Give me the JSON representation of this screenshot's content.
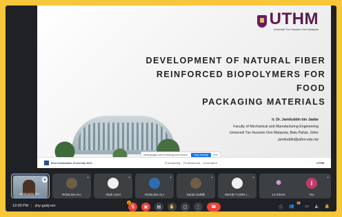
{
  "slide": {
    "logo": "UTHM",
    "logo_sub": "Universiti Tun Hussein Onn Malaysia",
    "title_lines": [
      "DEVELOPMENT OF NATURAL FIBER",
      "REINFORCED BIOPOLYMERS FOR FOOD",
      "PACKAGING MATERIALS"
    ],
    "author": {
      "name": "Ir. Dr. Jamiluddin bin Jaafar",
      "faculty": "Faculty of Mechanical and Manufacturing Engineering",
      "university": "Universiti Tun Hussein Onn Malaysia, Batu Pahat, Johor",
      "email": "jamiluddin@uthm.edu.my"
    },
    "share_bar": {
      "text": "meet.google.com is sharing your screen.",
      "stop": "Stop sharing",
      "hide": "Hide"
    },
    "footer": {
      "left": "Best Sustainable University 2023",
      "middle": "Trustworthy · Professional · Innovative",
      "right": "UTHM"
    }
  },
  "participants": [
    {
      "name": "Jamiluddin bin...",
      "type": "video"
    },
    {
      "name": "ROSLINA ALI",
      "type": "photo"
    },
    {
      "name": "Aliah Azmi",
      "type": "photo"
    },
    {
      "name": "ROSLINA ALI",
      "type": "photo"
    },
    {
      "name": "Sarah Zulkifli",
      "type": "photo"
    },
    {
      "name": "MOHD YUSRI I...",
      "type": "photo"
    },
    {
      "name": "13 others",
      "type": "others"
    },
    {
      "name": "You",
      "type": "initial",
      "initial": "I"
    }
  ],
  "bottom": {
    "time": "12:09 PM",
    "meeting_code": "yhy-gadj-ren",
    "raise_badge": "1",
    "people_count": "15"
  }
}
